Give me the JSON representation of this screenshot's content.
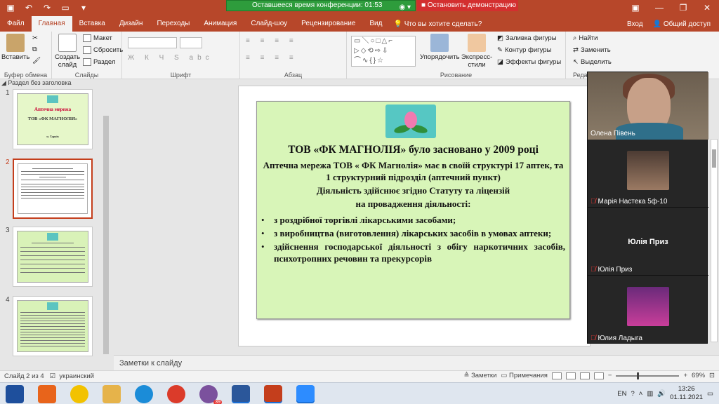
{
  "titlebar": {
    "conference_timer_label": "Оставшееся время конференции: 01:53",
    "stop_demo_label": "Остановить демонстрацию"
  },
  "tabs": [
    {
      "label": "Файл"
    },
    {
      "label": "Главная"
    },
    {
      "label": "Вставка"
    },
    {
      "label": "Дизайн"
    },
    {
      "label": "Переходы"
    },
    {
      "label": "Анимация"
    },
    {
      "label": "Слайд-шоу"
    },
    {
      "label": "Рецензирование"
    },
    {
      "label": "Вид"
    }
  ],
  "tell_me": "Что вы хотите сделать?",
  "sign_in": "Вход",
  "share": "Общий доступ",
  "ribbon": {
    "paste": "Вставить",
    "clipboard": "Буфер обмена",
    "new_slide": "Создать слайд",
    "layout": "Макет",
    "reset": "Сбросить",
    "section": "Раздел",
    "slides": "Слайды",
    "font": "Шрифт",
    "paragraph": "Абзац",
    "arrange": "Упорядочить",
    "quick_styles": "Экспресс-стили",
    "shape_fill": "Заливка фигуры",
    "shape_outline": "Контур фигуры",
    "shape_effects": "Эффекты фигуры",
    "drawing": "Рисование",
    "find": "Найти",
    "replace": "Заменить",
    "select": "Выделить",
    "editing": "Реда"
  },
  "section_header": "Раздел без заголовка",
  "thumbnails": [
    {
      "num": "1",
      "line1": "Аптечна мережа",
      "line2": "ТОВ «ФК МАГНОЛІЯ»",
      "line3": "м. Харків"
    },
    {
      "num": "2"
    },
    {
      "num": "3"
    },
    {
      "num": "4"
    }
  ],
  "slide": {
    "title": "ТОВ «ФК МАГНОЛІЯ» було засновано у 2009 році",
    "p1": "Аптечна мережа ТОВ « ФК Магнолія» має в своїй структурі 17 аптек, та 1 структурний підрозділ (аптечний пункт)",
    "p2": "Діяльність здійснює згідно Статуту та ліцензій",
    "p3": "на провадження діяльності:",
    "bullets": [
      "з роздрібної торгівлі лікарськими засобами;",
      "з виробництва (виготовлення) лікарських засобів в умовах аптеки;",
      "здійснення господарської діяльності з обігу наркотичних засобів, психотропних речовин та прекурсорів"
    ]
  },
  "notes_placeholder": "Заметки к слайду",
  "participants": [
    {
      "name": "Олена Півень",
      "muted": false
    },
    {
      "name": "Марія Настека 5ф-10",
      "muted": true
    },
    {
      "name": "Юлія Приз",
      "muted": true,
      "center_label": "Юлія Приз"
    },
    {
      "name": "Юлия Ладыга",
      "muted": true
    }
  ],
  "status": {
    "slide_of": "Слайд 2 из 4",
    "language": "украинский",
    "notes": "Заметки",
    "comments": "Примечания",
    "zoom": "69%",
    "zoom_level": 0.69
  },
  "taskbar": {
    "lang": "EN",
    "viber_badge": "39",
    "time": "13:26",
    "date": "01.11.2021"
  },
  "colors": {
    "accent": "#b7472a",
    "slide_bg": "#d8f5b8",
    "timer_green": "#2e9c3c",
    "stop_red": "#d32f2f"
  }
}
